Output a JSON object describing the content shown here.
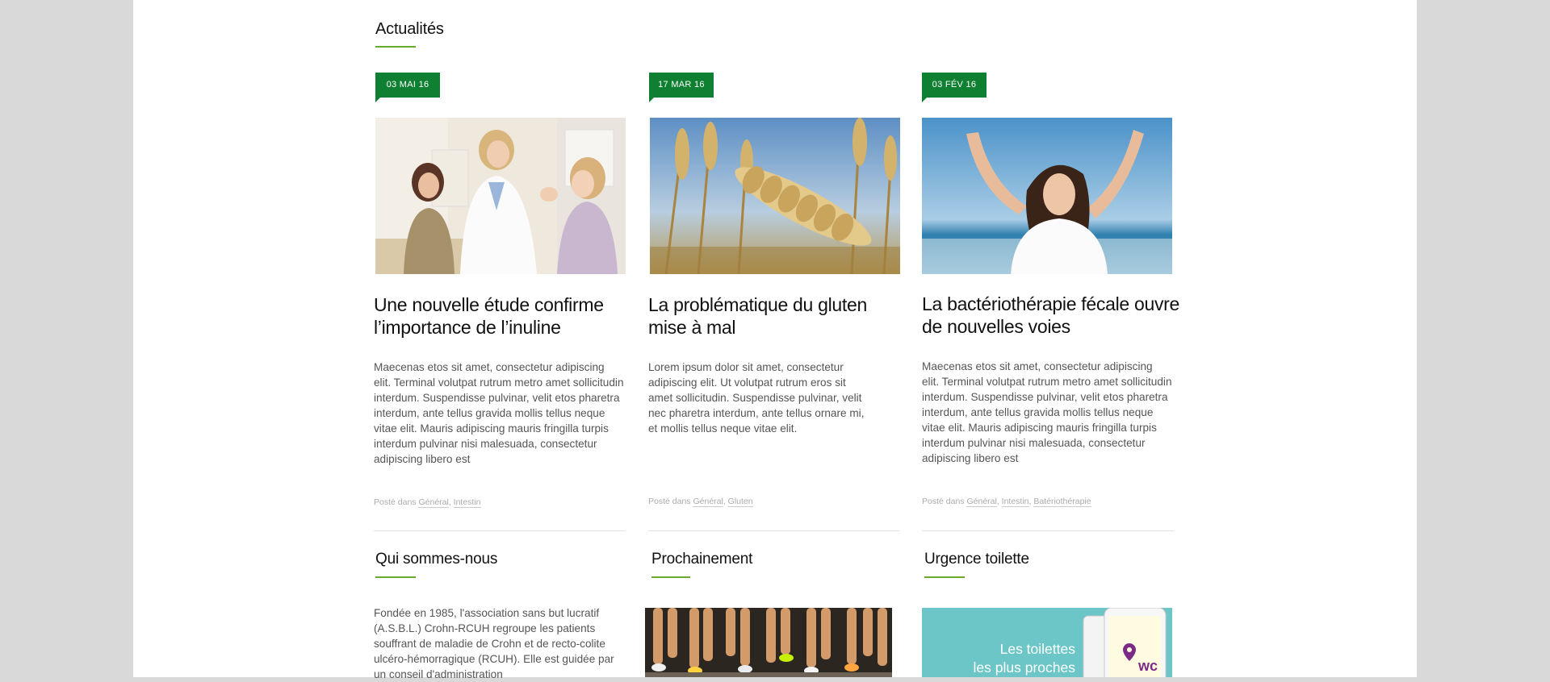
{
  "news": {
    "title": "Actualités",
    "cards": [
      {
        "date": "03 MAI 16",
        "image": "doctor-with-child-photo",
        "title": "Une nouvelle étude confirme l’importance de l’inuline",
        "excerpt": "Maecenas etos sit amet, consectetur adipiscing elit. Terminal volutpat rutrum metro amet sollicitudin interdum. Suspendisse pulvinar, velit etos pharetra interdum, ante tellus gravida mollis tellus neque vitae elit. Mauris adipiscing mauris fringilla turpis interdum pulvinar nisi malesuada, consectetur adipiscing libero est",
        "posted_prefix": "Posté dans",
        "tags": [
          "Général",
          "Intestin"
        ]
      },
      {
        "date": "17 MAR 16",
        "image": "wheat-field-photo",
        "title": "La problématique du gluten mise à mal",
        "excerpt": "Lorem ipsum dolor sit amet, consectetur adipiscing elit. Ut volutpat rutrum eros sit amet sollicitudin. Suspendisse pulvinar, velit nec pharetra interdum, ante tellus ornare mi, et mollis tellus neque vitae elit.",
        "posted_prefix": "Posté dans",
        "tags": [
          "Général",
          "Gluten"
        ]
      },
      {
        "date": "03 FÉV 16",
        "image": "woman-at-beach-photo",
        "title": "La bactériothérapie fécale ouvre de nouvelles voies",
        "excerpt": "Maecenas etos sit amet, consectetur adipiscing elit. Terminal volutpat rutrum metro amet sollicitudin interdum. Suspendisse pulvinar, velit etos pharetra interdum, ante tellus gravida mollis tellus neque vitae elit. Mauris adipiscing mauris fringilla turpis interdum pulvinar nisi malesuada, consectetur adipiscing libero est",
        "posted_prefix": "Posté dans",
        "tags": [
          "Général",
          "Intestin",
          "Batériothérapie"
        ]
      }
    ]
  },
  "about": {
    "title": "Qui sommes-nous",
    "text": "Fondée en 1985, l'association sans but lucratif (A.S.B.L.) Crohn-RCUH regroupe les patients souffrant de maladie de Crohn et de recto-colite ulcéro-hémorragique (RCUH). Elle est guidée par un conseil d'administration"
  },
  "upcoming": {
    "title": "Prochainement",
    "image": "marathon-runners-photo"
  },
  "toilet": {
    "title": "Urgence toilette",
    "caption_line1": "Les toilettes",
    "caption_line2": "les plus proches",
    "logo_text": "wc"
  },
  "colors": {
    "accent_green": "#0f7f32",
    "underline_green": "#6aaa2a",
    "app_teal": "#6cc6c8"
  }
}
